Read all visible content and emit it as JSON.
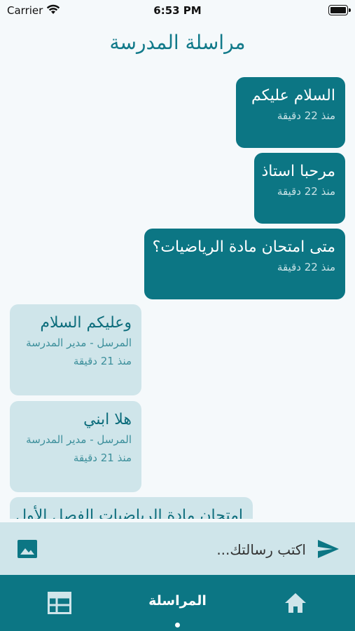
{
  "status": {
    "carrier": "Carrier",
    "time": "6:53 PM"
  },
  "header": {
    "title": "مراسلة المدرسة"
  },
  "messages": [
    {
      "direction": "sent",
      "text": "السلام عليكم",
      "time": "منذ 22 دقيقة"
    },
    {
      "direction": "sent",
      "text": "مرحبا استاذ",
      "time": "منذ 22 دقيقة"
    },
    {
      "direction": "sent",
      "text": "متى امتحان مادة الرياضيات؟",
      "time": "منذ 22 دقيقة"
    },
    {
      "direction": "received",
      "text": "وعليكم السلام",
      "sender": "المرسل - مدير المدرسة",
      "time": "منذ 21 دقيقة"
    },
    {
      "direction": "received",
      "text": "هلا ابني",
      "sender": "المرسل - مدير المدرسة",
      "time": "منذ 21 دقيقة"
    },
    {
      "direction": "received",
      "text": "امتحان مادة الرياضيات الفصل الأول",
      "sender": "",
      "time": ""
    }
  ],
  "composer": {
    "placeholder": "اكتب رسالتك..."
  },
  "tabbar": {
    "active_label": "المراسلة"
  },
  "colors": {
    "primary": "#0c7684",
    "received_bg": "#cfe5ea",
    "page_bg": "#f5f9fb"
  }
}
